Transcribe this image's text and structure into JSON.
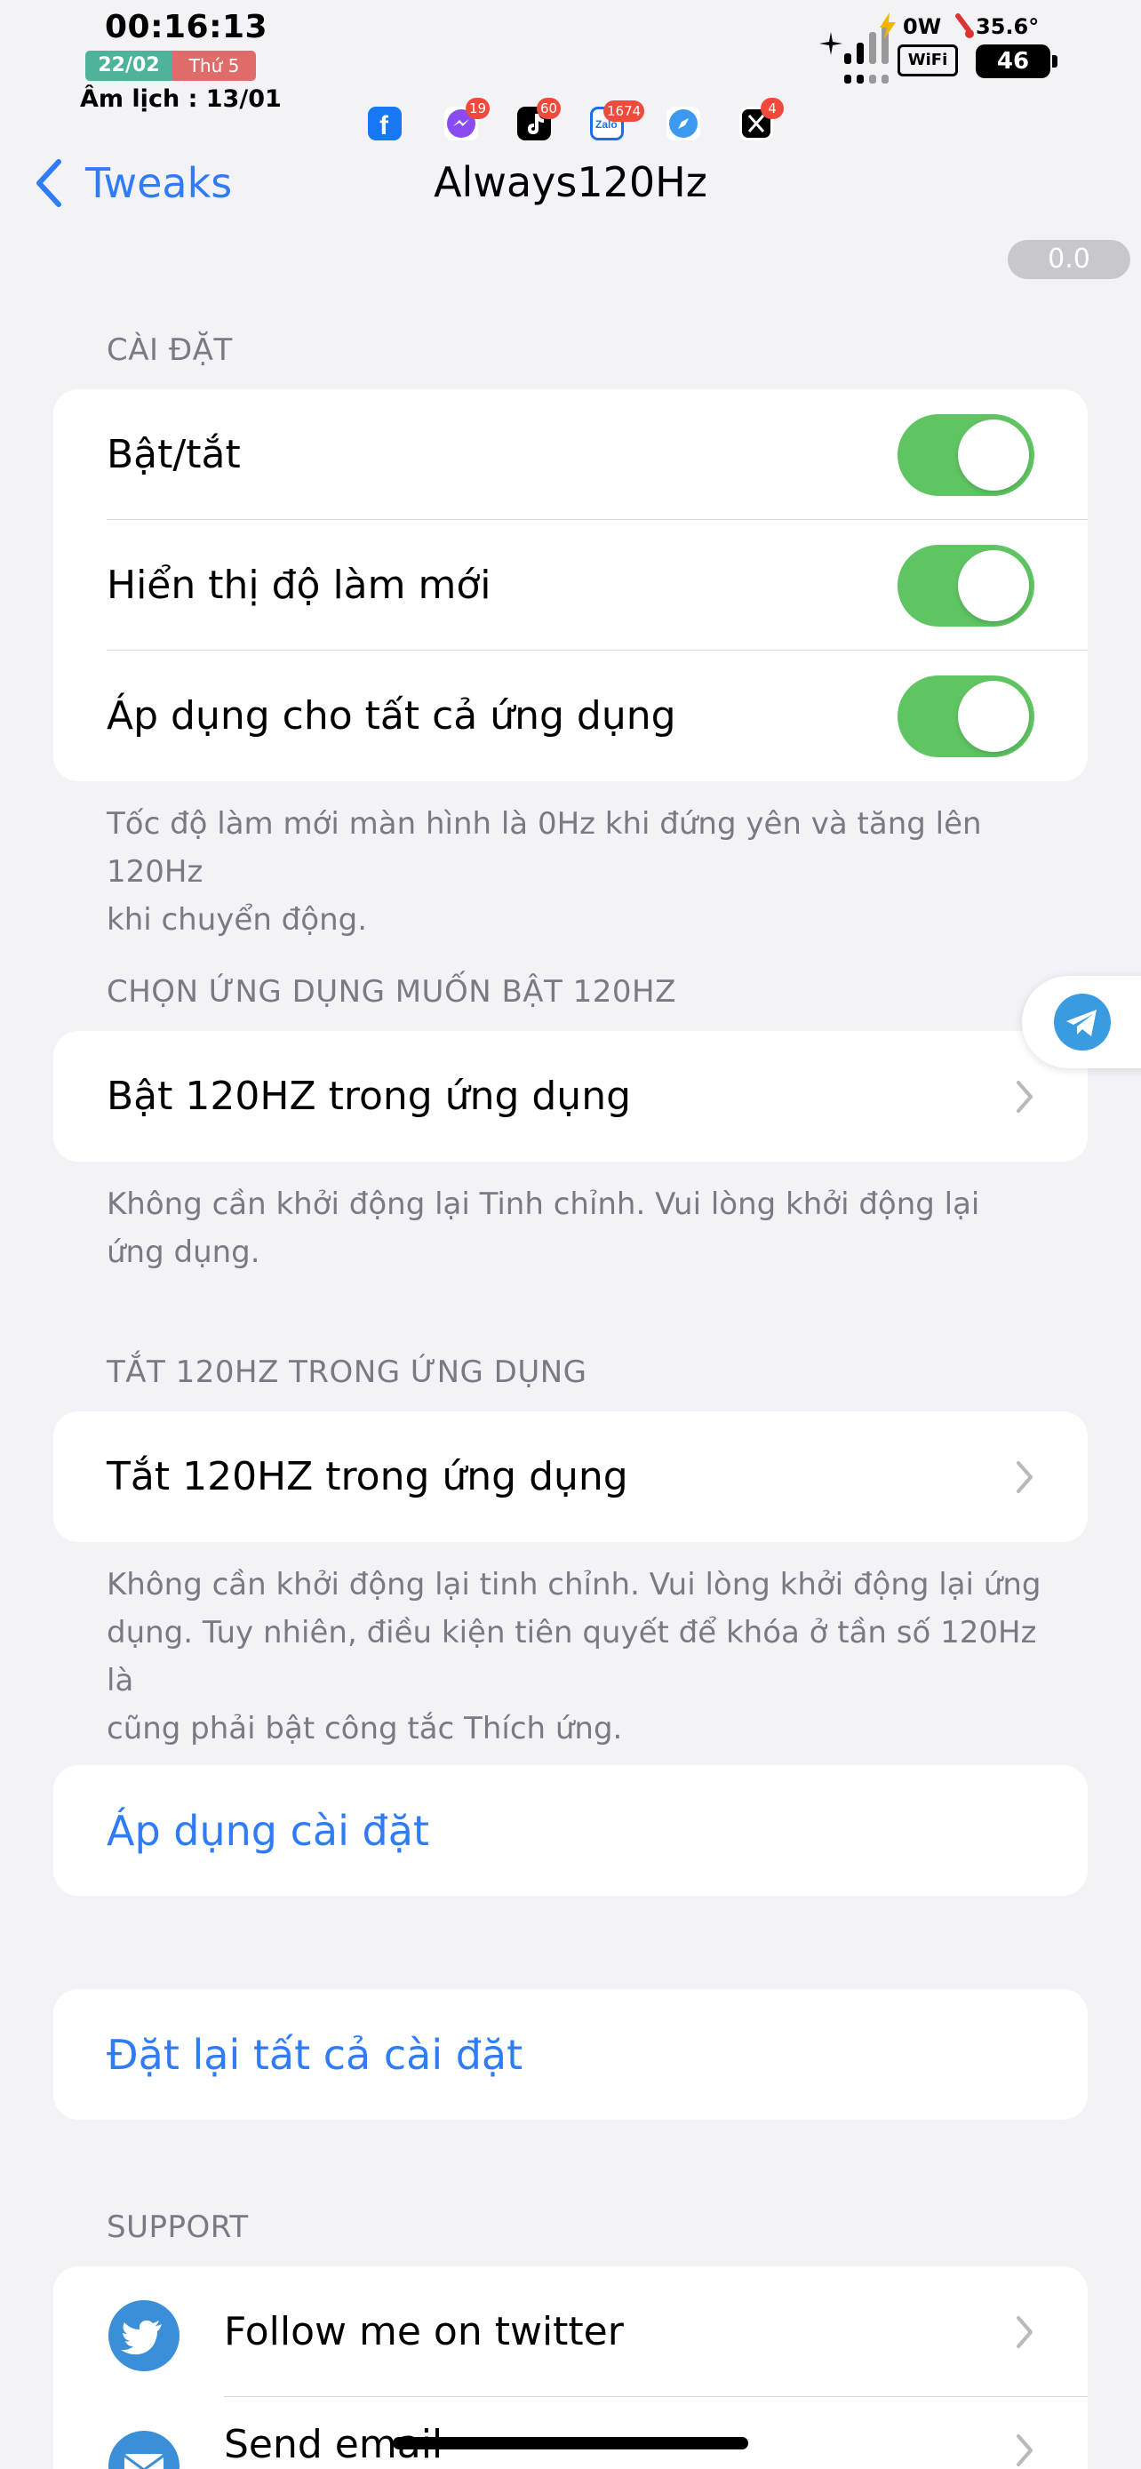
{
  "status_bar": {
    "time": "00:16:13",
    "date": "22/02",
    "weekday": "Thứ 5",
    "lunar": "Âm lịch : 13/01",
    "power": "0W",
    "temperature": "35.6°",
    "wifi": "WiFi",
    "battery": "46",
    "apps": [
      {
        "name": "facebook",
        "badge": ""
      },
      {
        "name": "messenger",
        "badge": "19"
      },
      {
        "name": "tiktok",
        "badge": "60"
      },
      {
        "name": "zalo",
        "badge": "1674"
      },
      {
        "name": "safari",
        "badge": ""
      },
      {
        "name": "x",
        "badge": "4"
      }
    ]
  },
  "nav": {
    "back_label": "Tweaks",
    "title": "Always120Hz",
    "version": "0.0"
  },
  "sections": {
    "settings": {
      "header": "CÀI ĐẶT",
      "rows": [
        {
          "label": "Bật/tắt",
          "on": true
        },
        {
          "label": "Hiển thị độ làm mới",
          "on": true
        },
        {
          "label": "Áp dụng cho tất cả ứng dụng",
          "on": true
        }
      ],
      "footer_line1": "Tốc độ làm mới màn hình là 0Hz khi đứng yên và tăng lên 120Hz",
      "footer_line2": "khi chuyển động."
    },
    "choose_apps": {
      "header": "CHỌN ỨNG DỤNG MUỐN BẬT 120HZ",
      "row": "Bật 120HZ trong ứng dụng",
      "footer_line1": "Không cần khởi động lại Tinh chỉnh. Vui lòng khởi động lại",
      "footer_line2": "ứng dụng."
    },
    "disable_apps": {
      "header": "TẮT 120HZ TRONG ỨNG DỤNG",
      "row": "Tắt 120HZ trong ứng dụng",
      "footer_line1": "Không cần khởi động lại tinh chỉnh. Vui lòng khởi động lại ứng",
      "footer_line2": "dụng. Tuy nhiên, điều kiện tiên quyết để khóa ở tần số 120Hz là",
      "footer_line3": "cũng phải bật công tắc Thích ứng."
    },
    "apply": {
      "label": "Áp dụng cài đặt"
    },
    "reset": {
      "label": "Đặt lại tất cả cài đặt"
    },
    "support": {
      "header": "SUPPORT",
      "rows": [
        {
          "label": "Follow me on twitter",
          "icon": "twitter-icon"
        },
        {
          "label": "Send email",
          "icon": "mail-icon"
        }
      ]
    }
  },
  "colors": {
    "accent": "#2f7cf6",
    "toggle_on": "#5fc562",
    "background": "#f2f2f7"
  }
}
